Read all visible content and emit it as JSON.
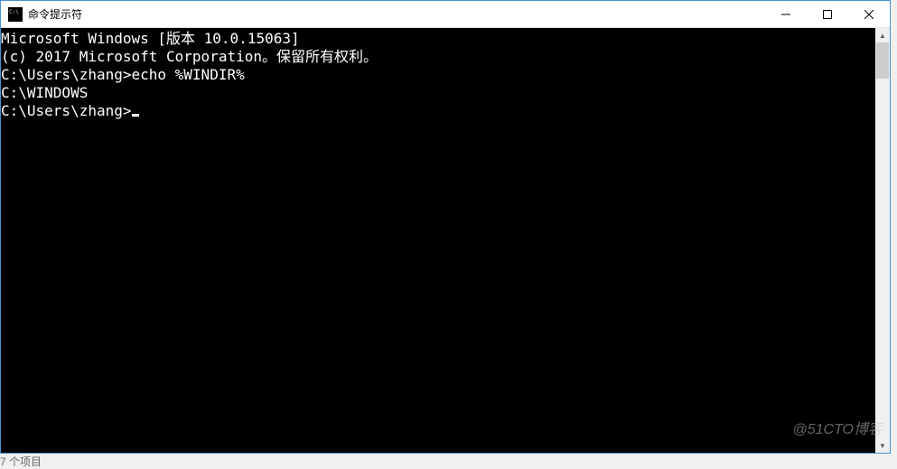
{
  "window": {
    "title": "命令提示符"
  },
  "terminal": {
    "lines": [
      "Microsoft Windows [版本 10.0.15063]",
      "(c) 2017 Microsoft Corporation。保留所有权利。",
      "",
      "C:\\Users\\zhang>echo %WINDIR%",
      "C:\\WINDOWS",
      "",
      "C:\\Users\\zhang>"
    ]
  },
  "watermark": "@51CTO博客",
  "footer": "7 个项目"
}
